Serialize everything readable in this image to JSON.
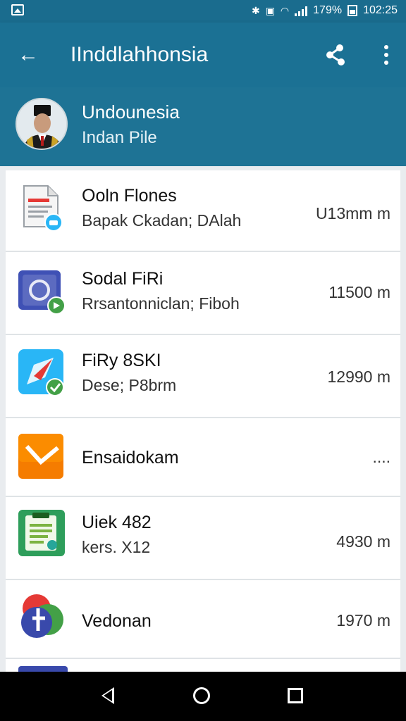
{
  "status": {
    "battery_percent": "179%",
    "time": "102:25"
  },
  "appbar": {
    "title": "IInddlahhonsia",
    "back_icon": "arrow-left-icon",
    "share_icon": "share-icon",
    "more_icon": "more-vert-icon"
  },
  "profile": {
    "name": "Undounesia",
    "subtitle": "Indan Pile"
  },
  "list": [
    {
      "title": "Ooln Flones",
      "subtitle": "Bapak Ckadan; DAlah",
      "value": "U13mm m",
      "icon": "document-icon"
    },
    {
      "title": "Sodal FiRi",
      "subtitle": "Rrsantonniclan; Fiboh",
      "value": "11500 m",
      "icon": "camera-app-icon"
    },
    {
      "title": "FiRy 8SKI",
      "subtitle": "Dese; P8brm",
      "value": "12990 m",
      "icon": "compass-icon"
    },
    {
      "title": "Ensaidokam",
      "subtitle": "",
      "value": "....",
      "icon": "mail-icon"
    },
    {
      "title": "Uiek 482",
      "subtitle": "kers. X12",
      "value": "4930 m",
      "icon": "notes-icon"
    },
    {
      "title": "Vedonan",
      "subtitle": "",
      "value": "1970 m",
      "icon": "colorful-app-icon"
    }
  ],
  "colors": {
    "appbar": "#1b7194",
    "statusbar": "#1a6c8e"
  }
}
